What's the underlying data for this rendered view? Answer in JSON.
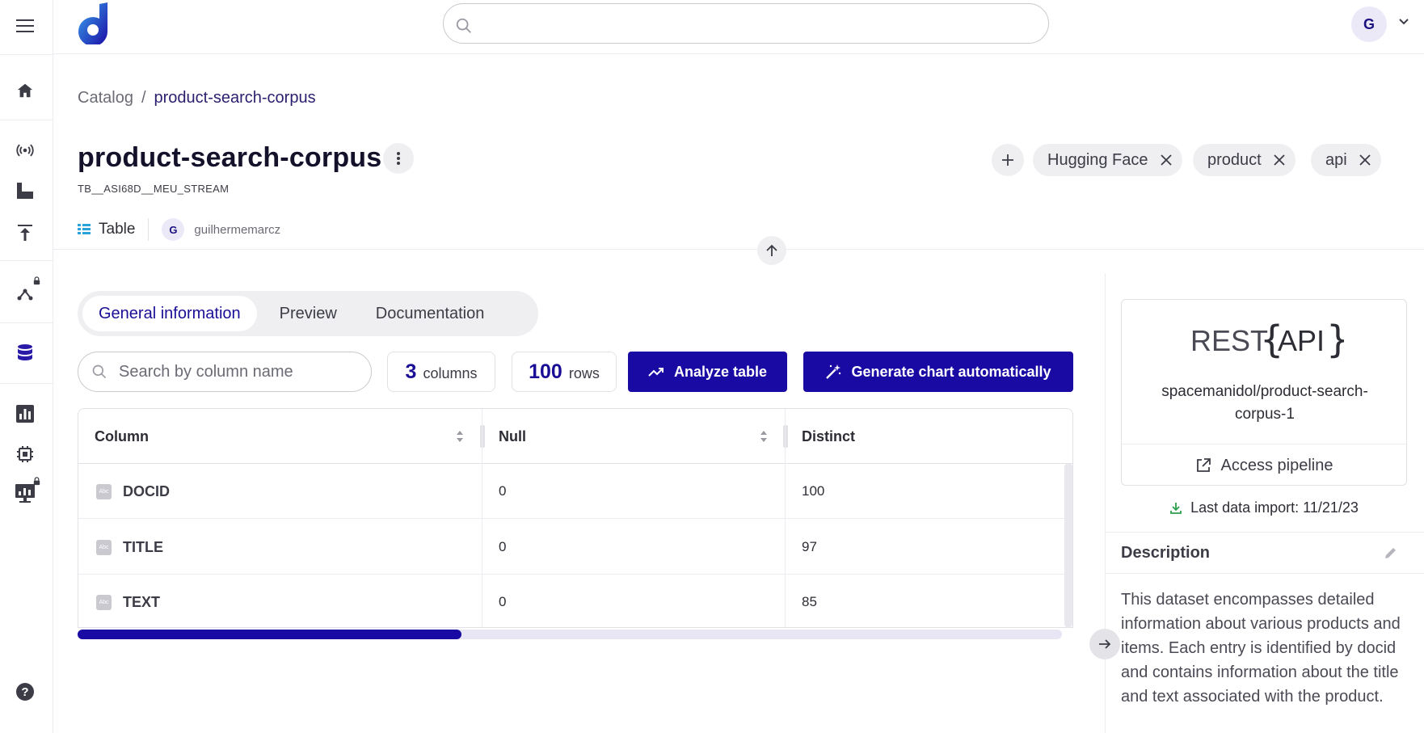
{
  "header": {
    "search_placeholder": "",
    "user_initial": "G"
  },
  "breadcrumb": {
    "root": "Catalog",
    "separator": "/",
    "current": "product-search-corpus"
  },
  "dataset": {
    "title": "product-search-corpus",
    "identifier": "TB__ASI68D__MEU_STREAM",
    "type_label": "Table",
    "owner_initial": "G",
    "owner_name": "guilhermemarcz",
    "tags": [
      "Hugging Face",
      "product",
      "api"
    ]
  },
  "tabs": [
    {
      "label": "General information",
      "active": true
    },
    {
      "label": "Preview",
      "active": false
    },
    {
      "label": "Documentation",
      "active": false
    }
  ],
  "toolbar": {
    "column_search_placeholder": "Search by column name",
    "columns_count": "3",
    "columns_label": "columns",
    "rows_count": "100",
    "rows_label": "rows",
    "analyze_label": "Analyze table",
    "generate_chart_label": "Generate chart automatically"
  },
  "table": {
    "headers": [
      "Column",
      "Null",
      "Distinct"
    ],
    "type_badge": "Abc",
    "rows": [
      {
        "column": "DOCID",
        "null": "0",
        "distinct": "100"
      },
      {
        "column": "TITLE",
        "null": "0",
        "distinct": "97"
      },
      {
        "column": "TEXT",
        "null": "0",
        "distinct": "85"
      }
    ],
    "horizontal_scroll_fraction": 0.39
  },
  "source": {
    "logo_text_left": "REST",
    "logo_text_right": "API",
    "pipeline_name": "spacemanidol/product-search-corpus-1",
    "access_label": "Access pipeline",
    "last_import": "Last data import: 11/21/23"
  },
  "description": {
    "title": "Description",
    "text": "This dataset encompasses detailed information about various products and items. Each entry is identified by docid and contains information about the title and text associated with the product."
  },
  "colors": {
    "primary": "#1a0aa4",
    "accent_text": "#1a0e96",
    "import_icon": "#2e9e4f",
    "table_icon": "#2aa3d8"
  }
}
